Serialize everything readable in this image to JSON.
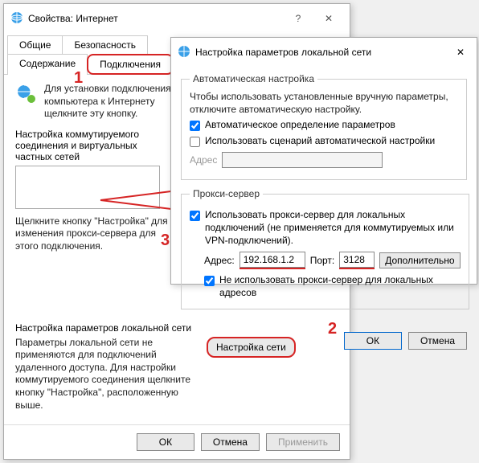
{
  "main": {
    "title": "Свойства: Интернет",
    "tabs": {
      "general": "Общие",
      "security": "Безопасность",
      "content": "Содержание",
      "connections": "Подключения"
    },
    "hint1": "Для установки подключения компьютера к Интернету щелкните эту кнопку.",
    "dialup_label": "Настройка коммутируемого соединения и виртуальных частных сетей",
    "proxy_hint": "Щелкните кнопку \"Настройка\" для изменения прокси-сервера для этого подключения.",
    "lan_section": "Настройка параметров локальной сети",
    "lan_hint": "Параметры локальной сети не применяются для подключений удаленного доступа. Для настройки коммутируемого соединения щелкните кнопку \"Настройка\", расположенную выше.",
    "lan_button": "Настройка сети",
    "ok": "ОК",
    "cancel": "Отмена",
    "apply": "Применить"
  },
  "lan": {
    "title": "Настройка параметров локальной сети",
    "auto_legend": "Автоматическая настройка",
    "auto_hint": "Чтобы использовать установленные вручную параметры, отключите автоматическую настройку.",
    "auto_detect": "Автоматическое определение параметров",
    "use_script": "Использовать сценарий автоматической настройки",
    "address_label": "Адрес",
    "proxy_legend": "Прокси-сервер",
    "use_proxy": "Использовать прокси-сервер для локальных подключений (не применяется для коммутируемых или VPN-подключений).",
    "addr_label": "Адрес:",
    "addr_value": "192.168.1.2",
    "port_label": "Порт:",
    "port_value": "3128",
    "advanced": "Дополнительно",
    "bypass_local": "Не использовать прокси-сервер для локальных адресов",
    "ok": "ОК",
    "cancel": "Отмена"
  },
  "annotations": {
    "n1": "1",
    "n2": "2",
    "n3": "3"
  }
}
